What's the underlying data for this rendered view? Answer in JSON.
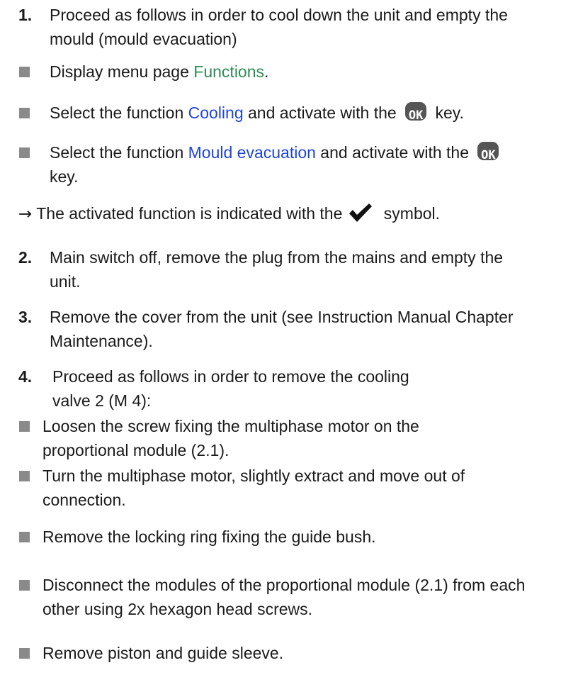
{
  "steps": {
    "s1": {
      "num": "1.",
      "text": "Proceed as follows in order to cool down the unit and empty the mould (mould evacuation)"
    },
    "b_functions": {
      "pre": "Display menu page ",
      "link": "Functions",
      "post": "."
    },
    "b_cooling": {
      "pre": "Select the function ",
      "link": "Cooling",
      "mid": " and activate with the",
      "post": " key."
    },
    "b_mould": {
      "pre": "Select the function ",
      "link": "Mould evacuation",
      "mid": " and activate with the",
      "post": "key."
    },
    "note": {
      "arrow": "→",
      "pre": " The activated function is indicated with the",
      "post": " symbol."
    },
    "s2": {
      "num": "2.",
      "text": "Main switch off, remove the plug from the mains and empty the unit."
    },
    "s3": {
      "num": "3.",
      "text": "Remove the cover from the unit (see Instruction Manual Chapter Maintenance)."
    },
    "s4": {
      "num": "4.",
      "text": "Proceed as follows in order to remove the cooling valve 2 (M 4):"
    },
    "b_loosen": "Loosen the screw fixing the multiphase motor on the proportional module (2.1).",
    "b_turn": "Turn the multiphase motor, slightly extract and move out of connection.",
    "b_ring": "Remove the locking ring fixing the guide bush.",
    "b_disconnect": "Disconnect the modules of the proportional module (2.1) from each other using 2x hexagon head screws.",
    "b_piston": "Remove piston and guide sleeve."
  },
  "ok_key_label": "OK",
  "colors": {
    "link_green": "#2e8b57",
    "link_blue": "#1f45d6",
    "bullet": "#8a8a8a",
    "key": "#555555"
  },
  "icons": {
    "bullet": "square-bullet",
    "ok_key": "ok-key-icon",
    "check": "checkmark-icon"
  }
}
